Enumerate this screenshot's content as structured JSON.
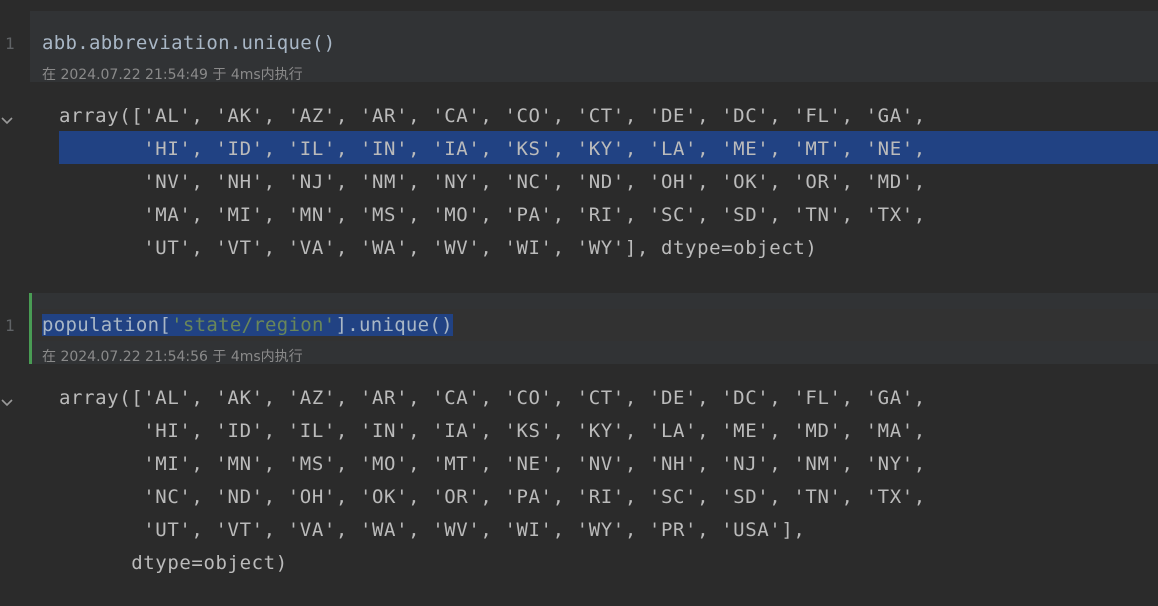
{
  "cells": [
    {
      "line_number": "1",
      "code": {
        "pre": "abb.abbreviation.unique()",
        "str": "",
        "post": ""
      },
      "exec_meta": "在 2024.07.22 21:54:49 于 4ms内执行",
      "output": [
        "array(['AL', 'AK', 'AZ', 'AR', 'CA', 'CO', 'CT', 'DE', 'DC', 'FL', 'GA',",
        "       'HI', 'ID', 'IL', 'IN', 'IA', 'KS', 'KY', 'LA', 'ME', 'MT', 'NE',",
        "       'NV', 'NH', 'NJ', 'NM', 'NY', 'NC', 'ND', 'OH', 'OK', 'OR', 'MD',",
        "       'MA', 'MI', 'MN', 'MS', 'MO', 'PA', 'RI', 'SC', 'SD', 'TN', 'TX',",
        "       'UT', 'VT', 'VA', 'WA', 'WV', 'WI', 'WY'], dtype=object)"
      ]
    },
    {
      "line_number": "1",
      "code": {
        "pre": "population[",
        "str": "'state/region'",
        "post": "].unique()"
      },
      "exec_meta": "在 2024.07.22 21:54:56 于 4ms内执行",
      "output": [
        "array(['AL', 'AK', 'AZ', 'AR', 'CA', 'CO', 'CT', 'DE', 'DC', 'FL', 'GA',",
        "       'HI', 'ID', 'IL', 'IN', 'IA', 'KS', 'KY', 'LA', 'ME', 'MD', 'MA',",
        "       'MI', 'MN', 'MS', 'MO', 'MT', 'NE', 'NV', 'NH', 'NJ', 'NM', 'NY',",
        "       'NC', 'ND', 'OH', 'OK', 'OR', 'PA', 'RI', 'SC', 'SD', 'TN', 'TX',",
        "       'UT', 'VT', 'VA', 'WA', 'WV', 'WI', 'WY', 'PR', 'USA'],",
        "      dtype=object)"
      ]
    }
  ],
  "colors": {
    "background": "#2b2b2b",
    "selection": "#214283",
    "string": "#6a8759",
    "active_cell_bar": "#499c54"
  },
  "icons": {
    "collapse": "chevron-down-icon"
  }
}
